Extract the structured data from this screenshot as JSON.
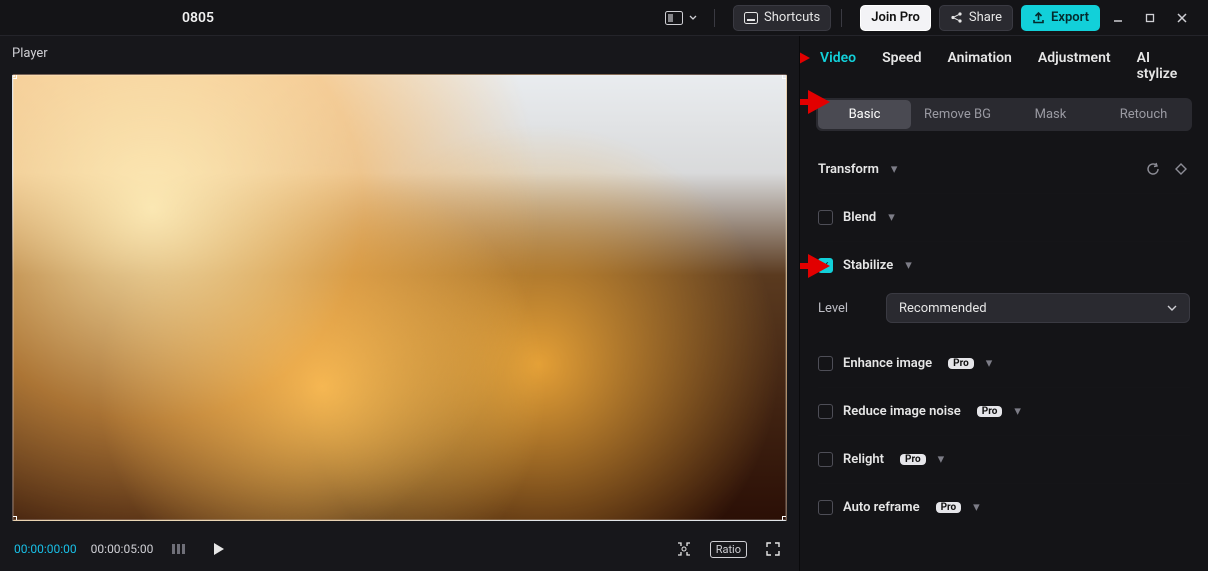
{
  "topbar": {
    "project_title": "0805",
    "buttons": {
      "layout_icon": "layout-grid",
      "shortcuts": "Shortcuts",
      "join_pro": "Join Pro",
      "share": "Share",
      "export": "Export"
    }
  },
  "player": {
    "header": "Player",
    "time_current": "00:00:00:00",
    "time_total": "00:00:05:00",
    "ratio_label": "Ratio"
  },
  "inspector": {
    "tabs": [
      "Video",
      "Speed",
      "Animation",
      "Adjustment",
      "AI stylize"
    ],
    "active_tab": "Video",
    "subtabs": [
      "Basic",
      "Remove BG",
      "Mask",
      "Retouch"
    ],
    "active_subtab": "Basic",
    "sections": {
      "transform": {
        "label": "Transform"
      },
      "blend": {
        "label": "Blend",
        "checked": false
      },
      "stabilize": {
        "label": "Stabilize",
        "checked": true,
        "level_label": "Level",
        "level_value": "Recommended"
      },
      "enhance": {
        "label": "Enhance image",
        "checked": false,
        "pro": true,
        "pro_badge": "Pro"
      },
      "noise": {
        "label": "Reduce image noise",
        "checked": false,
        "pro": true,
        "pro_badge": "Pro"
      },
      "relight": {
        "label": "Relight",
        "checked": false,
        "pro": true,
        "pro_badge": "Pro"
      },
      "reframe": {
        "label": "Auto reframe",
        "checked": false,
        "pro": true,
        "pro_badge": "Pro"
      }
    }
  }
}
